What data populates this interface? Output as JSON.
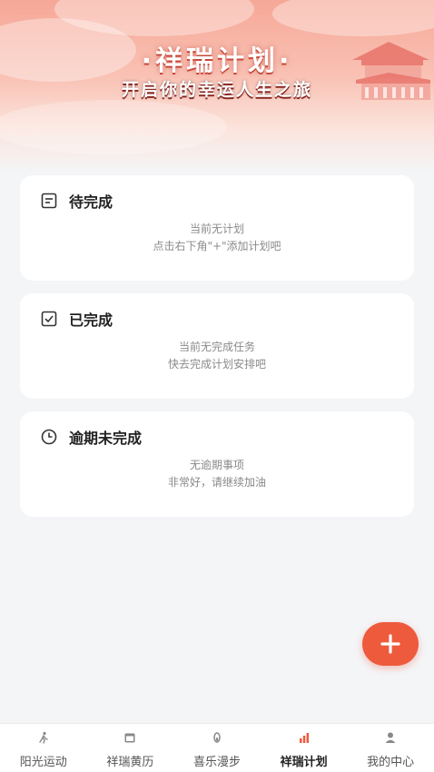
{
  "header": {
    "title": "·祥瑞计划·",
    "subtitle": "开启你的幸运人生之旅"
  },
  "cards": [
    {
      "icon": "list-icon",
      "title": "待完成",
      "line1": "当前无计划",
      "line2": "点击右下角\"+\"添加计划吧"
    },
    {
      "icon": "checkbox-icon",
      "title": "已完成",
      "line1": "当前无完成任务",
      "line2": "快去完成计划安排吧"
    },
    {
      "icon": "clock-icon",
      "title": "逾期未完成",
      "line1": "无逾期事项",
      "line2": "非常好，请继续加油"
    }
  ],
  "fab": {
    "icon": "plus-icon"
  },
  "tabbar": {
    "active_index": 3,
    "items": [
      {
        "icon": "runner-icon",
        "label": "阳光运动"
      },
      {
        "icon": "calendar-icon",
        "label": "祥瑞黄历"
      },
      {
        "icon": "footprint-icon",
        "label": "喜乐漫步"
      },
      {
        "icon": "bar-chart-icon",
        "label": "祥瑞计划"
      },
      {
        "icon": "person-icon",
        "label": "我的中心"
      }
    ]
  },
  "colors": {
    "accent": "#ee5a3c",
    "hero_top": "#f6a897",
    "background": "#f4f5f7"
  }
}
